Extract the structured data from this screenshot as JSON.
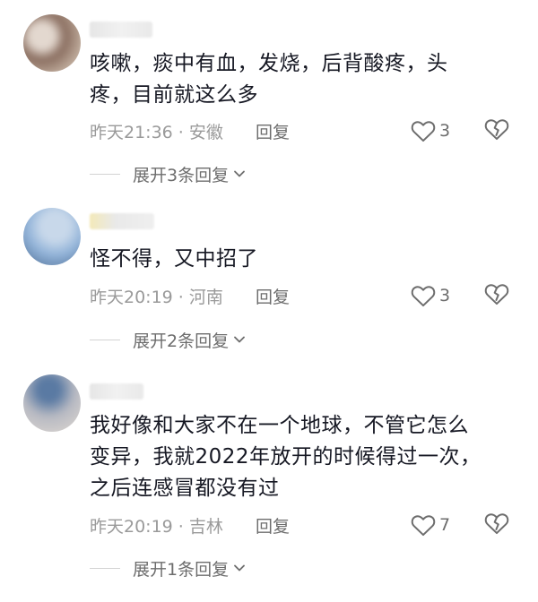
{
  "comments": [
    {
      "text_lines": [
        "咳嗽，痰中有血，发烧，后背酸疼，头",
        "疼，目前就这么多"
      ],
      "time": "昨天21:36 · 安徽",
      "reply_label": "回复",
      "likes": "3",
      "expand_label": "展开3条回复",
      "avatar_colors": [
        "#c9b7a7",
        "#8a6e60",
        "#e3d8cf"
      ]
    },
    {
      "text_lines": [
        "怪不得，又中招了"
      ],
      "time": "昨天20:19 · 河南",
      "reply_label": "回复",
      "likes": "3",
      "expand_label": "展开2条回复",
      "avatar_colors": [
        "#93b4d9",
        "#5f7fa6",
        "#c8d8ea"
      ]
    },
    {
      "text_lines": [
        "我好像和大家不在一个地球，不管它怎么",
        "变异，我就2022年放开的时候得过一次，",
        "之后连感冒都没有过"
      ],
      "time": "昨天20:19 · 吉林",
      "reply_label": "回复",
      "likes": "7",
      "expand_label": "展开1条回复",
      "avatar_colors": [
        "#b7b9c2",
        "#5a7aa3",
        "#d9d4cf"
      ]
    }
  ],
  "icons": {
    "like": "heart-outline-icon",
    "dislike": "broken-heart-outline-icon",
    "expand": "chevron-down-icon"
  },
  "colors": {
    "text": "#161823",
    "meta": "#9a9a9a",
    "secondary": "#6d6d6d"
  }
}
